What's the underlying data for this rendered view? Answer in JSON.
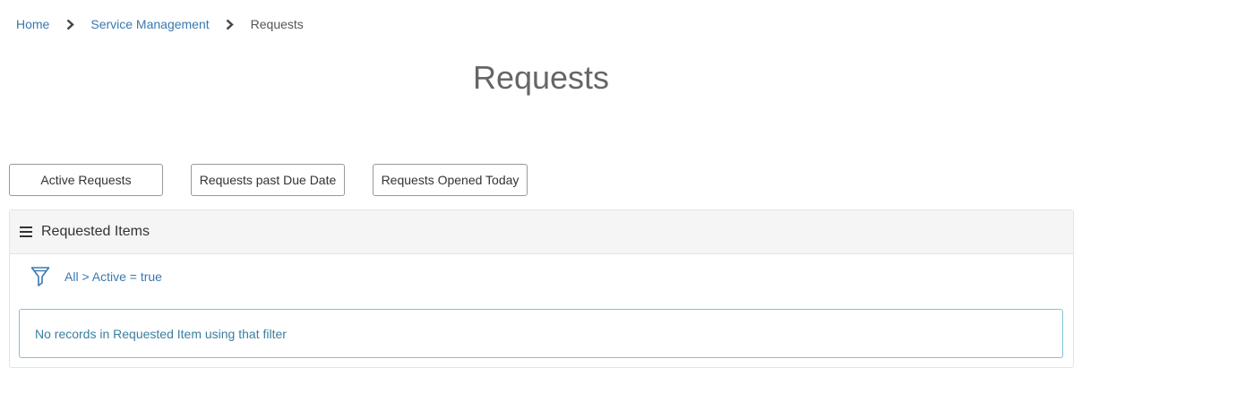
{
  "breadcrumb": {
    "items": [
      {
        "label": "Home"
      },
      {
        "label": "Service Management"
      },
      {
        "label": "Requests"
      }
    ]
  },
  "page": {
    "title": "Requests"
  },
  "tabs": [
    {
      "label": "Active Requests"
    },
    {
      "label": "Requests past Due Date"
    },
    {
      "label": "Requests Opened Today"
    }
  ],
  "panel": {
    "title": "Requested Items",
    "filter_text": "All > Active = true",
    "empty_message": "No records in Requested Item using that filter"
  },
  "icons": {
    "breadcrumb_separator": "chevron-right-icon",
    "panel_menu": "hamburger-menu-icon",
    "filter": "funnel-icon"
  },
  "colors": {
    "link": "#3a78b0",
    "alert_border": "#7fc4d4",
    "alert_text": "#3a7fa0",
    "panel_header_bg": "#f5f5f5"
  }
}
